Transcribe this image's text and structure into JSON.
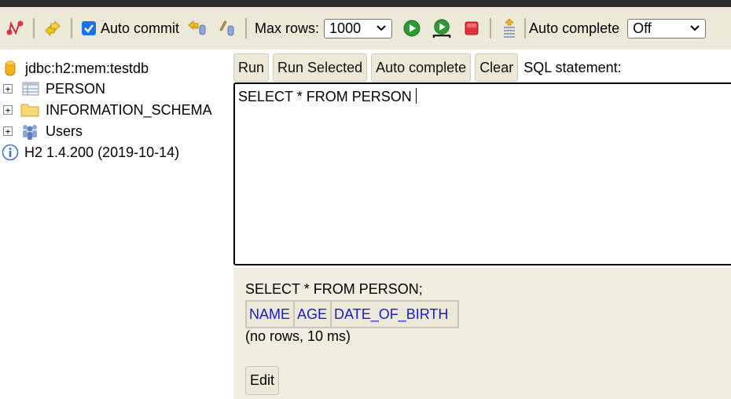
{
  "toolbar": {
    "auto_commit_label": "Auto commit",
    "auto_commit_checked": true,
    "max_rows_label": "Max rows:",
    "max_rows_value": "1000",
    "auto_complete_label": "Auto complete",
    "auto_complete_value": "Off",
    "icons": [
      "disconnect-icon",
      "refresh-icon",
      "rollback-icon",
      "commit-icon",
      "run-icon",
      "run-selected-icon",
      "stop-icon",
      "history-icon"
    ]
  },
  "sidebar": {
    "connection": "jdbc:h2:mem:testdb",
    "items": [
      {
        "label": "PERSON",
        "icon": "table-icon"
      },
      {
        "label": "INFORMATION_SCHEMA",
        "icon": "folder-icon"
      },
      {
        "label": "Users",
        "icon": "users-icon"
      }
    ],
    "version": "H2 1.4.200 (2019-10-14)"
  },
  "editor": {
    "buttons": {
      "run": "Run",
      "run_selected": "Run Selected",
      "auto_complete": "Auto complete",
      "clear": "Clear"
    },
    "label": "SQL statement:",
    "value": "SELECT * FROM PERSON"
  },
  "result": {
    "statement": "SELECT * FROM PERSON;",
    "columns": [
      "NAME",
      "AGE",
      "DATE_OF_BIRTH"
    ],
    "note": "(no rows, 10 ms)",
    "edit_label": "Edit"
  },
  "colors": {
    "toolbar_bg": "#ece9d8",
    "result_bg": "#f1ede0",
    "column_link": "#1a1ad6"
  }
}
